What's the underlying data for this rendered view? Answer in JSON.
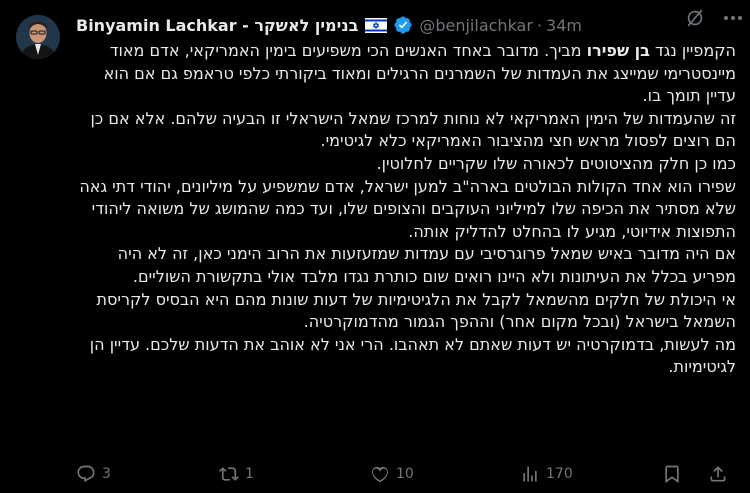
{
  "post": {
    "display_name": "Binyamin Lachkar - בנימין לאשקר",
    "handle": "@benjilachkar",
    "separator": "·",
    "time": "34m",
    "flag_icon": "israel-flag-icon",
    "verified_color": "#1d9bf0",
    "paragraphs": [
      {
        "before": "הקמפיין נגד ",
        "mention": "בן שפירו",
        "after": " מביך. מדובר באחד האנשים הכי משפיעים בימין האמריקאי, אדם מאוד מיינסטרימי שמייצג את העמדות של השמרנים הרגילים ומאוד ביקורתי כלפי טראמפ גם אם הוא עדיין תומך בו."
      },
      {
        "text": "זה שהעמדות של הימין האמריקאי לא נוחות למרכז שמאל הישראלי זו הבעיה שלהם. אלא אם כן הם רוצים לפסול מראש חצי מהציבור האמריקאי כלא לגיטימי."
      },
      {
        "text": "כמו כן חלק מהציטוטים לכאורה שלו שקריים לחלוטין."
      },
      {
        "text": "שפירו הוא אחד הקולות הבולטים בארה\"ב למען ישראל, אדם שמשפיע על מיליונים, יהודי דתי גאה שלא מסתיר את הכיפה שלו למיליוני העוקבים והצופים שלו, ועד כמה שהמושג של משואה ליהודי התפוצות אידיוטי, מגיע לו בהחלט להדליק אותה."
      },
      {
        "text": "אם היה מדובר באיש שמאל פרוגרסיבי עם עמדות שמזעזעות את הרוב הימני כאן, זה לא היה מפריע בכלל את העיתונות ולא היינו רואים שום כותרת נגדו מלבד אולי בתקשורת השוליים."
      },
      {
        "text": "אי היכולת של חלקים מהשמאל לקבל את הלגיטימיות של דעות שונות מהם היא הבסיס לקריסת השמאל בישראל (ובכל מקום אחר) וההפך הגמור מהדמוקרטיה."
      },
      {
        "text": "מה לעשות, בדמוקרטיה יש דעות שאתם לא תאהבו. הרי אני לא אוהב את הדעות שלכם. עדיין הן לגיטימיות."
      }
    ]
  },
  "actions": {
    "replies": "3",
    "reposts": "1",
    "likes": "10",
    "views": "170",
    "reply_icon": "reply-icon",
    "repost_icon": "repost-icon",
    "like_icon": "heart-icon",
    "views_icon": "views-icon",
    "bookmark_icon": "bookmark-icon",
    "share_icon": "share-icon"
  }
}
